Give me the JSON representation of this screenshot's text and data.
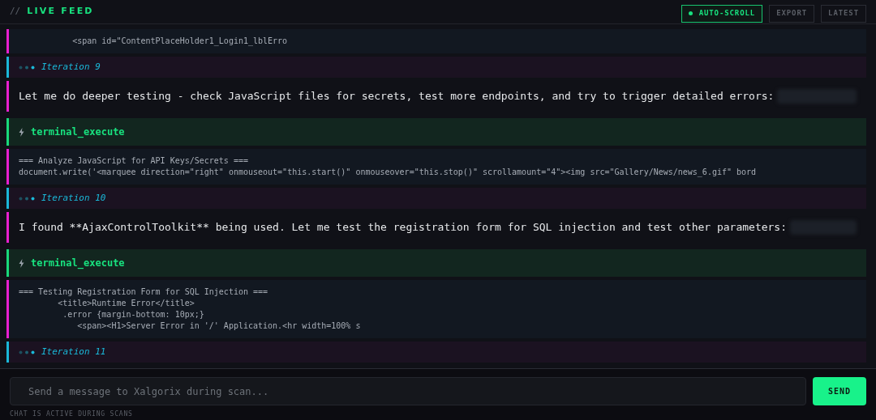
{
  "header": {
    "prefix": "//",
    "title": "LIVE FEED",
    "auto_scroll": {
      "label": "AUTO-SCROLL",
      "on": true
    },
    "buttons": [
      "EXPORT",
      "LATEST"
    ]
  },
  "feed": [
    {
      "kind": "output",
      "lines": [
        "           <span id=\"ContentPlaceHolder1_Login1_lblErro"
      ]
    },
    {
      "kind": "iteration",
      "label": "Iteration 9"
    },
    {
      "kind": "message",
      "text": "Let me do deeper testing - check JavaScript files for secrets, test more endpoints, and try to trigger detailed errors:",
      "redacted": true
    },
    {
      "kind": "tool",
      "label": "terminal_execute"
    },
    {
      "kind": "output",
      "lines": [
        "=== Analyze JavaScript for API Keys/Secrets ===",
        "document.write('<marquee direction=\"right\" onmouseout=\"this.start()\" onmouseover=\"this.stop()\" scrollamount=\"4\"><img src=\"Gallery/News/news_6.gif\" bord"
      ]
    },
    {
      "kind": "iteration",
      "label": "Iteration 10"
    },
    {
      "kind": "message",
      "text": "I found **AjaxControlToolkit** being used. Let me test the registration form for SQL injection and test other parameters:",
      "redacted": true
    },
    {
      "kind": "tool",
      "label": "terminal_execute"
    },
    {
      "kind": "output",
      "lines": [
        "=== Testing Registration Form for SQL Injection ===",
        "        <title>Runtime Error</title>",
        "         .error {margin-bottom: 10px;}",
        "            <span><H1>Server Error in '/' Application.<hr width=100% s"
      ]
    },
    {
      "kind": "iteration",
      "label": "Iteration 11"
    }
  ],
  "composer": {
    "placeholder": "Send a message to Xalgorix during scan...",
    "send": "SEND",
    "note": "CHAT IS ACTIVE DURING SCANS"
  }
}
